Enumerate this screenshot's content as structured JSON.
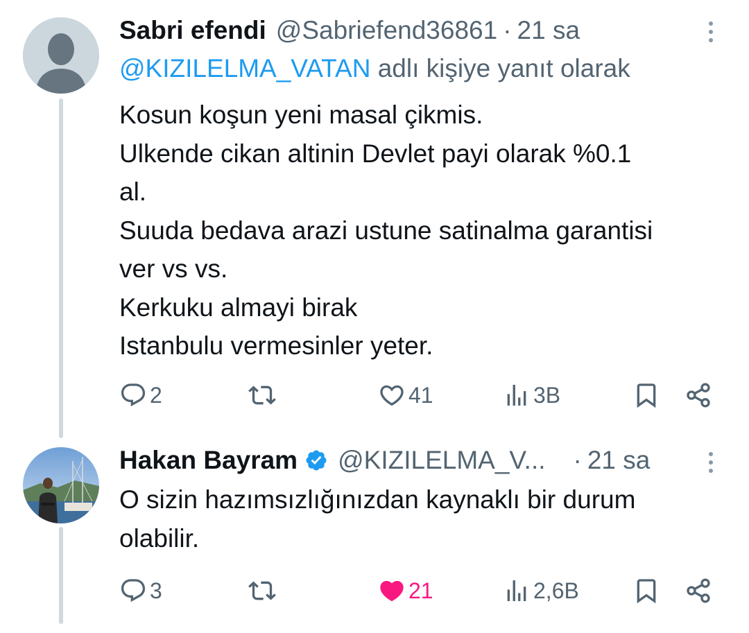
{
  "colors": {
    "text": "#0f1419",
    "secondary": "#536471",
    "link": "#1d9bf0",
    "like_active": "#f91880",
    "thread_line": "#cfd9de",
    "verified": "#1d9bf0"
  },
  "tweets": [
    {
      "display_name": "Sabri efendi",
      "handle": "@Sabriefend36861",
      "separator": "·",
      "time": "21 sa",
      "reply_to": {
        "mention": "@KIZILELMA_VATAN",
        "suffix": "adlı kişiye yanıt olarak"
      },
      "text_lines": [
        "Kosun koşun yeni masal çikmis.",
        "Ulkende cikan altinin Devlet payi olarak %0.1",
        "al.",
        "Suuda bedava arazi ustune satinalma garantisi",
        "ver vs vs.",
        "Kerkuku almayi birak",
        "Istanbulu vermesinler yeter."
      ],
      "actions": {
        "replies": "2",
        "retweets": "",
        "likes": "41",
        "views": "3B",
        "liked": false
      }
    },
    {
      "display_name": "Hakan Bayram",
      "verified": true,
      "handle": "@KIZILELMA_V...",
      "separator": "·",
      "time": "21 sa",
      "text_lines": [
        "O sizin hazımsızlığınızdan kaynaklı bir durum",
        "olabilir."
      ],
      "actions": {
        "replies": "3",
        "retweets": "",
        "likes": "21",
        "views": "2,6B",
        "liked": true
      }
    }
  ],
  "icons": {
    "reply": "speech-bubble-icon",
    "retweet": "retweet-arrows-icon",
    "like": "heart-icon",
    "views": "bar-chart-icon",
    "bookmark": "bookmark-icon",
    "share": "share-nodes-icon",
    "more": "vertical-dots-icon",
    "verified": "verified-badge-icon",
    "default_avatar": "default-profile-avatar"
  }
}
